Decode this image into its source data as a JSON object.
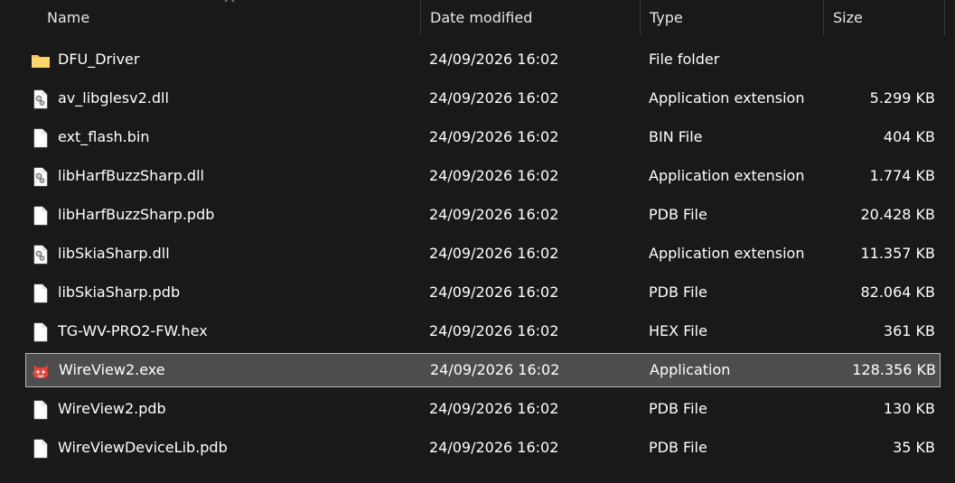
{
  "columns": {
    "name": "Name",
    "date": "Date modified",
    "type": "Type",
    "size": "Size"
  },
  "files": [
    {
      "name": "DFU_Driver",
      "date": "24/09/2026 16:02",
      "type": "File folder",
      "size": "",
      "icon": "folder-icon"
    },
    {
      "name": "av_libglesv2.dll",
      "date": "24/09/2026 16:02",
      "type": "Application extension",
      "size": "5.299 KB",
      "icon": "dll-file-icon"
    },
    {
      "name": "ext_flash.bin",
      "date": "24/09/2026 16:02",
      "type": "BIN File",
      "size": "404 KB",
      "icon": "file-icon"
    },
    {
      "name": "libHarfBuzzSharp.dll",
      "date": "24/09/2026 16:02",
      "type": "Application extension",
      "size": "1.774 KB",
      "icon": "dll-file-icon"
    },
    {
      "name": "libHarfBuzzSharp.pdb",
      "date": "24/09/2026 16:02",
      "type": "PDB File",
      "size": "20.428 KB",
      "icon": "file-icon"
    },
    {
      "name": "libSkiaSharp.dll",
      "date": "24/09/2026 16:02",
      "type": "Application extension",
      "size": "11.357 KB",
      "icon": "dll-file-icon"
    },
    {
      "name": "libSkiaSharp.pdb",
      "date": "24/09/2026 16:02",
      "type": "PDB File",
      "size": "82.064 KB",
      "icon": "file-icon"
    },
    {
      "name": "TG-WV-PRO2-FW.hex",
      "date": "24/09/2026 16:02",
      "type": "HEX File",
      "size": "361 KB",
      "icon": "file-icon"
    },
    {
      "name": "WireView2.exe",
      "date": "24/09/2026 16:02",
      "type": "Application",
      "size": "128.356 KB",
      "icon": "app-exe-icon"
    },
    {
      "name": "WireView2.pdb",
      "date": "24/09/2026 16:02",
      "type": "PDB File",
      "size": "130 KB",
      "icon": "file-icon"
    },
    {
      "name": "WireViewDeviceLib.pdb",
      "date": "24/09/2026 16:02",
      "type": "PDB File",
      "size": "35 KB",
      "icon": "file-icon"
    }
  ],
  "selected_file": "WireView2.exe",
  "colors": {
    "background": "#191919",
    "selected_bg": "#4d4d4d",
    "selected_border": "#b9b9b9",
    "folder": "#f8c54c",
    "exe_accent": "#e8453c"
  }
}
